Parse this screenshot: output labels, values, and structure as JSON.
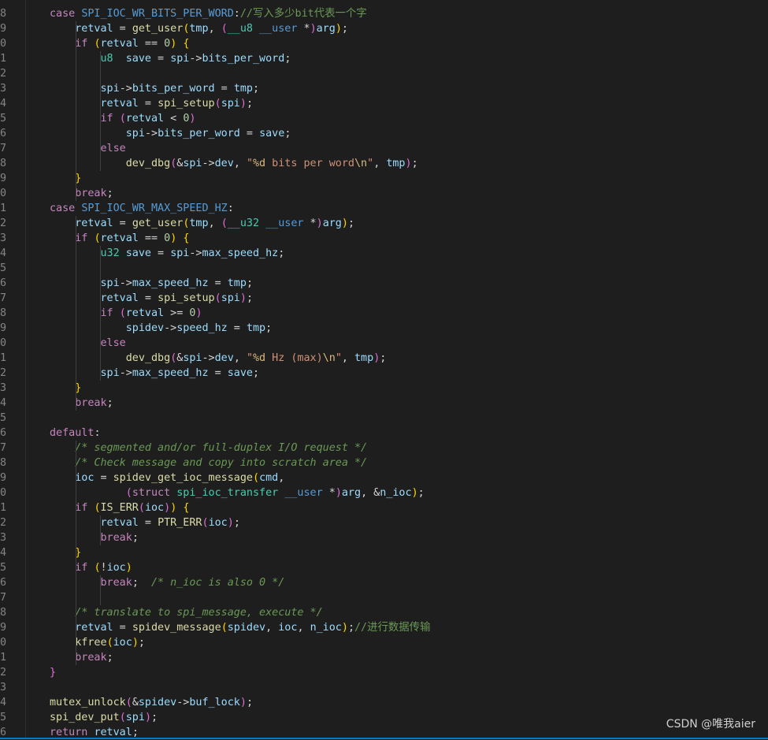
{
  "editor": {
    "line_numbers": [
      "8",
      "9",
      "0",
      "1",
      "2",
      "3",
      "4",
      "5",
      "6",
      "7",
      "8",
      "9",
      "0",
      "1",
      "2",
      "3",
      "4",
      "5",
      "6",
      "7",
      "8",
      "9",
      "0",
      "1",
      "2",
      "3",
      "4",
      "5",
      "6",
      "7",
      "8",
      "9",
      "0",
      "1",
      "2",
      "3",
      "4",
      "5",
      "6",
      "7",
      "8",
      "9",
      "0",
      "1",
      "2",
      "3",
      "4",
      "5",
      "6"
    ],
    "lines": [
      [
        [
          "kw",
          "case "
        ],
        [
          "mac",
          "SPI_IOC_WR_BITS_PER_WORD"
        ],
        [
          "pu",
          ":"
        ],
        [
          "cmn",
          "//写入多少bit代表一个字"
        ]
      ],
      [
        [
          "var",
          "    retval"
        ],
        [
          "pu",
          " = "
        ],
        [
          "fn",
          "get_user"
        ],
        [
          "br1",
          "("
        ],
        [
          "var",
          "tmp"
        ],
        [
          "pu",
          ", "
        ],
        [
          "br2",
          "("
        ],
        [
          "ty",
          "__u8"
        ],
        [
          "pu",
          " "
        ],
        [
          "mac",
          "__user"
        ],
        [
          "pu",
          " *"
        ],
        [
          "br2",
          ")"
        ],
        [
          "var",
          "arg"
        ],
        [
          "br1",
          ")"
        ],
        [
          "pu",
          ";"
        ]
      ],
      [
        [
          "kw",
          "    if "
        ],
        [
          "br1",
          "("
        ],
        [
          "var",
          "retval"
        ],
        [
          "pu",
          " == "
        ],
        [
          "num",
          "0"
        ],
        [
          "br1",
          ")"
        ],
        [
          "pu",
          " "
        ],
        [
          "br1",
          "{"
        ]
      ],
      [
        [
          "ty",
          "        u8"
        ],
        [
          "pu",
          "  "
        ],
        [
          "var",
          "save"
        ],
        [
          "pu",
          " = "
        ],
        [
          "var",
          "spi"
        ],
        [
          "pu",
          "->"
        ],
        [
          "var",
          "bits_per_word"
        ],
        [
          "pu",
          ";"
        ]
      ],
      [
        [
          "pu",
          ""
        ]
      ],
      [
        [
          "var",
          "        spi"
        ],
        [
          "pu",
          "->"
        ],
        [
          "var",
          "bits_per_word"
        ],
        [
          "pu",
          " = "
        ],
        [
          "var",
          "tmp"
        ],
        [
          "pu",
          ";"
        ]
      ],
      [
        [
          "var",
          "        retval"
        ],
        [
          "pu",
          " = "
        ],
        [
          "fn",
          "spi_setup"
        ],
        [
          "br2",
          "("
        ],
        [
          "var",
          "spi"
        ],
        [
          "br2",
          ")"
        ],
        [
          "pu",
          ";"
        ]
      ],
      [
        [
          "kw",
          "        if "
        ],
        [
          "br2",
          "("
        ],
        [
          "var",
          "retval"
        ],
        [
          "pu",
          " < "
        ],
        [
          "num",
          "0"
        ],
        [
          "br2",
          ")"
        ]
      ],
      [
        [
          "var",
          "            spi"
        ],
        [
          "pu",
          "->"
        ],
        [
          "var",
          "bits_per_word"
        ],
        [
          "pu",
          " = "
        ],
        [
          "var",
          "save"
        ],
        [
          "pu",
          ";"
        ]
      ],
      [
        [
          "kw",
          "        else"
        ]
      ],
      [
        [
          "fn",
          "            dev_dbg"
        ],
        [
          "br2",
          "("
        ],
        [
          "pu",
          "&"
        ],
        [
          "var",
          "spi"
        ],
        [
          "pu",
          "->"
        ],
        [
          "var",
          "dev"
        ],
        [
          "pu",
          ", "
        ],
        [
          "str",
          "\""
        ],
        [
          "esc",
          "%d"
        ],
        [
          "str",
          " bits per word"
        ],
        [
          "esc",
          "\\n"
        ],
        [
          "str",
          "\""
        ],
        [
          "pu",
          ", "
        ],
        [
          "var",
          "tmp"
        ],
        [
          "br2",
          ")"
        ],
        [
          "pu",
          ";"
        ]
      ],
      [
        [
          "br1",
          "    }"
        ]
      ],
      [
        [
          "kw",
          "    break"
        ],
        [
          "pu",
          ";"
        ]
      ],
      [
        [
          "kw",
          "case "
        ],
        [
          "mac",
          "SPI_IOC_WR_MAX_SPEED_HZ"
        ],
        [
          "pu",
          ":"
        ]
      ],
      [
        [
          "var",
          "    retval"
        ],
        [
          "pu",
          " = "
        ],
        [
          "fn",
          "get_user"
        ],
        [
          "br1",
          "("
        ],
        [
          "var",
          "tmp"
        ],
        [
          "pu",
          ", "
        ],
        [
          "br2",
          "("
        ],
        [
          "ty",
          "__u32"
        ],
        [
          "pu",
          " "
        ],
        [
          "mac",
          "__user"
        ],
        [
          "pu",
          " *"
        ],
        [
          "br2",
          ")"
        ],
        [
          "var",
          "arg"
        ],
        [
          "br1",
          ")"
        ],
        [
          "pu",
          ";"
        ]
      ],
      [
        [
          "kw",
          "    if "
        ],
        [
          "br1",
          "("
        ],
        [
          "var",
          "retval"
        ],
        [
          "pu",
          " == "
        ],
        [
          "num",
          "0"
        ],
        [
          "br1",
          ")"
        ],
        [
          "pu",
          " "
        ],
        [
          "br1",
          "{"
        ]
      ],
      [
        [
          "ty",
          "        u32"
        ],
        [
          "pu",
          " "
        ],
        [
          "var",
          "save"
        ],
        [
          "pu",
          " = "
        ],
        [
          "var",
          "spi"
        ],
        [
          "pu",
          "->"
        ],
        [
          "var",
          "max_speed_hz"
        ],
        [
          "pu",
          ";"
        ]
      ],
      [
        [
          "pu",
          ""
        ]
      ],
      [
        [
          "var",
          "        spi"
        ],
        [
          "pu",
          "->"
        ],
        [
          "var",
          "max_speed_hz"
        ],
        [
          "pu",
          " = "
        ],
        [
          "var",
          "tmp"
        ],
        [
          "pu",
          ";"
        ]
      ],
      [
        [
          "var",
          "        retval"
        ],
        [
          "pu",
          " = "
        ],
        [
          "fn",
          "spi_setup"
        ],
        [
          "br2",
          "("
        ],
        [
          "var",
          "spi"
        ],
        [
          "br2",
          ")"
        ],
        [
          "pu",
          ";"
        ]
      ],
      [
        [
          "kw",
          "        if "
        ],
        [
          "br2",
          "("
        ],
        [
          "var",
          "retval"
        ],
        [
          "pu",
          " >= "
        ],
        [
          "num",
          "0"
        ],
        [
          "br2",
          ")"
        ]
      ],
      [
        [
          "var",
          "            spidev"
        ],
        [
          "pu",
          "->"
        ],
        [
          "var",
          "speed_hz"
        ],
        [
          "pu",
          " = "
        ],
        [
          "var",
          "tmp"
        ],
        [
          "pu",
          ";"
        ]
      ],
      [
        [
          "kw",
          "        else"
        ]
      ],
      [
        [
          "fn",
          "            dev_dbg"
        ],
        [
          "br2",
          "("
        ],
        [
          "pu",
          "&"
        ],
        [
          "var",
          "spi"
        ],
        [
          "pu",
          "->"
        ],
        [
          "var",
          "dev"
        ],
        [
          "pu",
          ", "
        ],
        [
          "str",
          "\""
        ],
        [
          "esc",
          "%d"
        ],
        [
          "str",
          " Hz (max)"
        ],
        [
          "esc",
          "\\n"
        ],
        [
          "str",
          "\""
        ],
        [
          "pu",
          ", "
        ],
        [
          "var",
          "tmp"
        ],
        [
          "br2",
          ")"
        ],
        [
          "pu",
          ";"
        ]
      ],
      [
        [
          "var",
          "        spi"
        ],
        [
          "pu",
          "->"
        ],
        [
          "var",
          "max_speed_hz"
        ],
        [
          "pu",
          " = "
        ],
        [
          "var",
          "save"
        ],
        [
          "pu",
          ";"
        ]
      ],
      [
        [
          "br1",
          "    }"
        ]
      ],
      [
        [
          "kw",
          "    break"
        ],
        [
          "pu",
          ";"
        ]
      ],
      [
        [
          "pu",
          ""
        ]
      ],
      [
        [
          "kw",
          "default"
        ],
        [
          "pu",
          ":"
        ]
      ],
      [
        [
          "cm",
          "    /* segmented and/or full-duplex I/O request */"
        ]
      ],
      [
        [
          "cm",
          "    /* Check message and copy into scratch area */"
        ]
      ],
      [
        [
          "var",
          "    ioc"
        ],
        [
          "pu",
          " = "
        ],
        [
          "fn",
          "spidev_get_ioc_message"
        ],
        [
          "br1",
          "("
        ],
        [
          "var",
          "cmd"
        ],
        [
          "pu",
          ","
        ]
      ],
      [
        [
          "br2",
          "            ("
        ],
        [
          "kw",
          "struct"
        ],
        [
          "pu",
          " "
        ],
        [
          "ty",
          "spi_ioc_transfer"
        ],
        [
          "pu",
          " "
        ],
        [
          "mac",
          "__user"
        ],
        [
          "pu",
          " *"
        ],
        [
          "br2",
          ")"
        ],
        [
          "var",
          "arg"
        ],
        [
          "pu",
          ", &"
        ],
        [
          "var",
          "n_ioc"
        ],
        [
          "br1",
          ")"
        ],
        [
          "pu",
          ";"
        ]
      ],
      [
        [
          "kw",
          "    if "
        ],
        [
          "br1",
          "("
        ],
        [
          "fn",
          "IS_ERR"
        ],
        [
          "br2",
          "("
        ],
        [
          "var",
          "ioc"
        ],
        [
          "br2",
          ")"
        ],
        [
          "br1",
          ")"
        ],
        [
          "pu",
          " "
        ],
        [
          "br1",
          "{"
        ]
      ],
      [
        [
          "var",
          "        retval"
        ],
        [
          "pu",
          " = "
        ],
        [
          "fn",
          "PTR_ERR"
        ],
        [
          "br2",
          "("
        ],
        [
          "var",
          "ioc"
        ],
        [
          "br2",
          ")"
        ],
        [
          "pu",
          ";"
        ]
      ],
      [
        [
          "kw",
          "        break"
        ],
        [
          "pu",
          ";"
        ]
      ],
      [
        [
          "br1",
          "    }"
        ]
      ],
      [
        [
          "kw",
          "    if "
        ],
        [
          "br1",
          "("
        ],
        [
          "pu",
          "!"
        ],
        [
          "var",
          "ioc"
        ],
        [
          "br1",
          ")"
        ]
      ],
      [
        [
          "kw",
          "        break"
        ],
        [
          "pu",
          ";  "
        ],
        [
          "cm",
          "/* n_ioc is also 0 */"
        ]
      ],
      [
        [
          "pu",
          ""
        ]
      ],
      [
        [
          "cm",
          "    /* translate to spi_message, execute */"
        ]
      ],
      [
        [
          "var",
          "    retval"
        ],
        [
          "pu",
          " = "
        ],
        [
          "fn",
          "spidev_message"
        ],
        [
          "br1",
          "("
        ],
        [
          "var",
          "spidev"
        ],
        [
          "pu",
          ", "
        ],
        [
          "var",
          "ioc"
        ],
        [
          "pu",
          ", "
        ],
        [
          "var",
          "n_ioc"
        ],
        [
          "br1",
          ")"
        ],
        [
          "pu",
          ";"
        ],
        [
          "cmn",
          "//进行数据传输"
        ]
      ],
      [
        [
          "fn",
          "    kfree"
        ],
        [
          "br1",
          "("
        ],
        [
          "var",
          "ioc"
        ],
        [
          "br1",
          ")"
        ],
        [
          "pu",
          ";"
        ]
      ],
      [
        [
          "kw",
          "    break"
        ],
        [
          "pu",
          ";"
        ]
      ],
      [
        [
          "br2",
          "}"
        ]
      ],
      [
        [
          "pu",
          ""
        ]
      ],
      [
        [
          "fn",
          "mutex_unlock"
        ],
        [
          "br2",
          "("
        ],
        [
          "pu",
          "&"
        ],
        [
          "var",
          "spidev"
        ],
        [
          "pu",
          "->"
        ],
        [
          "var",
          "buf_lock"
        ],
        [
          "br2",
          ")"
        ],
        [
          "pu",
          ";"
        ]
      ],
      [
        [
          "fn",
          "spi_dev_put"
        ],
        [
          "br2",
          "("
        ],
        [
          "var",
          "spi"
        ],
        [
          "br2",
          ")"
        ],
        [
          "pu",
          ";"
        ]
      ],
      [
        [
          "kw",
          "return "
        ],
        [
          "var",
          "retval"
        ],
        [
          "pu",
          ";"
        ]
      ]
    ]
  },
  "watermark": {
    "text": "CSDN @唯我aier"
  },
  "colors": {
    "background": "#1e1e1e",
    "keyword": "#c586c0",
    "function": "#dcdcaa",
    "type": "#4ec9b0",
    "variable": "#9cdcfe",
    "number": "#b5cea8",
    "string": "#ce9178",
    "comment": "#6a9955",
    "line_number": "#858585"
  }
}
